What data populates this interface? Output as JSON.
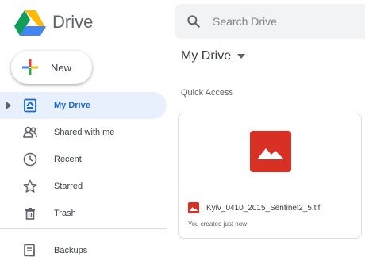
{
  "app": {
    "name": "Drive"
  },
  "search": {
    "placeholder": "Search Drive"
  },
  "new_button": {
    "label": "New"
  },
  "sidebar": {
    "items": [
      {
        "label": "My Drive",
        "icon": "my-drive-icon",
        "active": true
      },
      {
        "label": "Shared with me",
        "icon": "shared-with-me-icon"
      },
      {
        "label": "Recent",
        "icon": "clock-icon"
      },
      {
        "label": "Starred",
        "icon": "star-icon"
      },
      {
        "label": "Trash",
        "icon": "trash-icon"
      }
    ],
    "backups": {
      "label": "Backups",
      "icon": "backups-icon"
    }
  },
  "main": {
    "title": "My Drive",
    "quick_access_label": "Quick Access",
    "files": [
      {
        "name": "Kyiv_0410_2015_Sentinel2_5.tif",
        "meta": "You created just now",
        "icon": "image-file-icon"
      }
    ]
  },
  "colors": {
    "accent": "#1967d2",
    "active_bg": "#e8f0fe",
    "file_red": "#d93025",
    "search_bg": "#f1f3f4"
  }
}
